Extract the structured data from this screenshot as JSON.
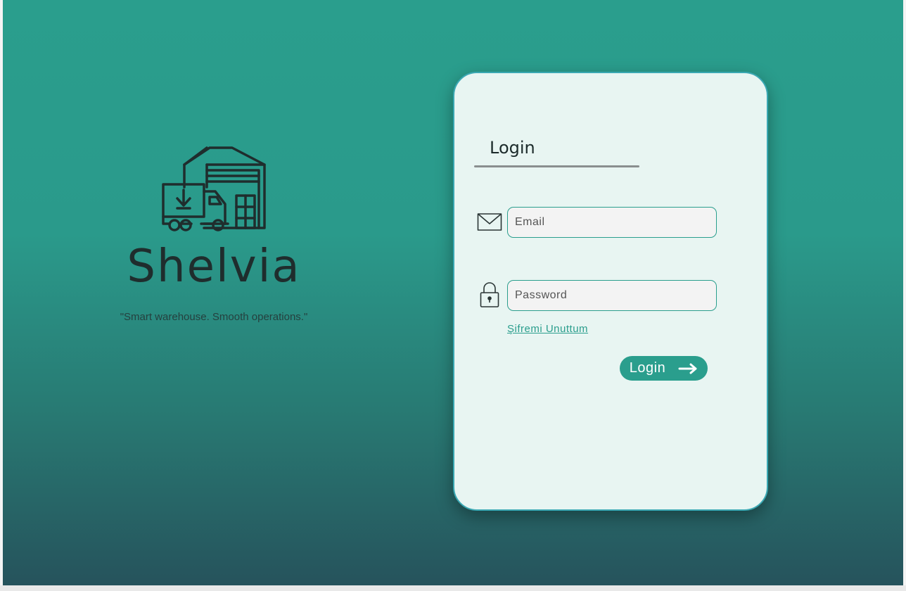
{
  "brand": {
    "name": "Shelvia",
    "tagline": "\"Smart warehouse. Smooth operations.\"",
    "logo_icon": "warehouse-truck-icon"
  },
  "login_card": {
    "title": "Login",
    "email": {
      "placeholder": "Email",
      "value": "",
      "icon": "mail-icon"
    },
    "password": {
      "placeholder": "Password",
      "value": "",
      "icon": "lock-icon"
    },
    "forgot_password_label": "Şifremi Unuttum",
    "login_button_label": "Login",
    "login_button_icon": "arrow-right-icon"
  },
  "colors": {
    "accent": "#2a9e8d",
    "card_background": "#e8f5f2",
    "gradient_top": "#2a9e8d",
    "gradient_bottom": "#26535c"
  }
}
